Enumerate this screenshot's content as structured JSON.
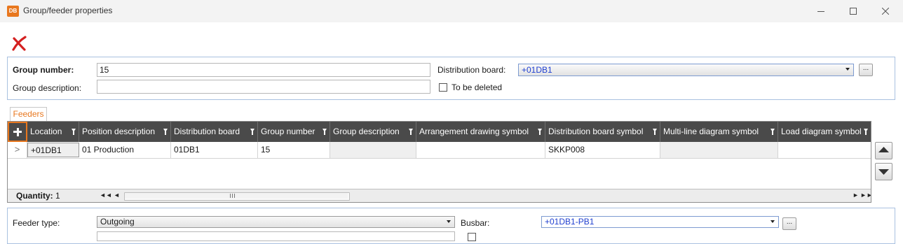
{
  "window": {
    "app_icon_text": "DB",
    "title": "Group/feeder properties"
  },
  "toolbar": {
    "delete_icon": "red-x-delete-icon"
  },
  "header": {
    "group_number_label": "Group number:",
    "group_number_value": "15",
    "group_description_label": "Group description:",
    "group_description_value": "",
    "distribution_board_label": "Distribution board:",
    "distribution_board_value": "+01DB1",
    "to_be_deleted_label": "To be deleted",
    "to_be_deleted_checked": false
  },
  "tabs": {
    "feeders": "Feeders"
  },
  "grid": {
    "columns": [
      "Location",
      "Position description",
      "Distribution board",
      "Group number",
      "Group description",
      "Arrangement drawing symbol",
      "Distribution board symbol",
      "Multi-line diagram symbol",
      "Load diagram symbol"
    ],
    "rows": [
      [
        "+01DB1",
        "01 Production",
        "01DB1",
        "15",
        "",
        "",
        "SKKP008",
        "",
        ""
      ]
    ],
    "quantity_label": "Quantity:",
    "quantity_value": "1"
  },
  "feeder": {
    "feeder_type_label": "Feeder type:",
    "feeder_type_value": "Outgoing",
    "busbar_label": "Busbar:",
    "busbar_value": "+01DB1-PB1"
  },
  "colors": {
    "accent": "#e8771e",
    "grid_header": "#4a4a4a",
    "link_blue": "#1f3fd0",
    "group_border": "#a9c1e0"
  }
}
